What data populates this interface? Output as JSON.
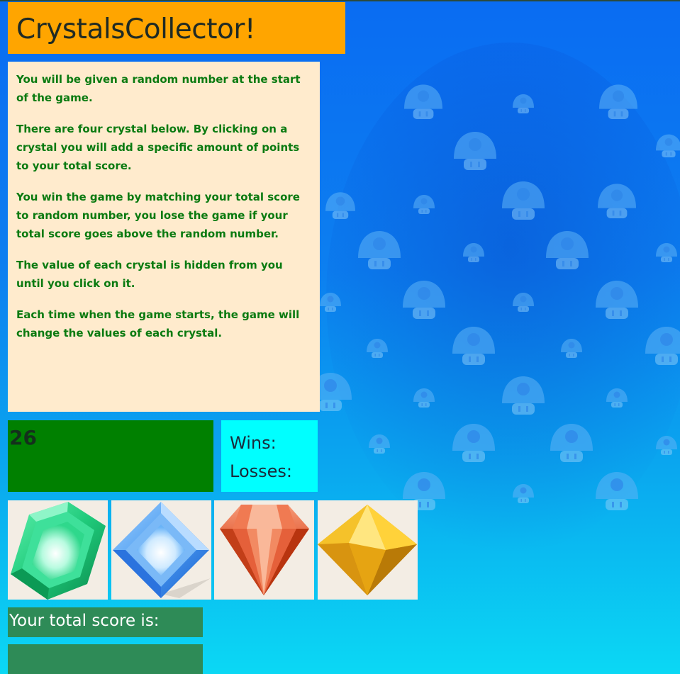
{
  "title": "CrystalsCollector!",
  "instructions": [
    "You will be given a random number at the start of the game.",
    "There are four crystal below. By clicking on a crystal you will add a specific amount of points to your total score.",
    "You win the game by matching your total score to random number, you lose the game if your total score goes above the random number.",
    "The value of each crystal is hidden from you until you click on it.",
    "Each time when the game starts, the game will change the values of each crystal."
  ],
  "random_number": "26",
  "stats": {
    "wins_label": "Wins:",
    "losses_label": "Losses:"
  },
  "crystals": [
    {
      "icon": "green-emerald-icon",
      "color": "#1fc97a"
    },
    {
      "icon": "blue-diamond-icon",
      "color": "#4a9bf0"
    },
    {
      "icon": "red-ruby-icon",
      "color": "#e0522a"
    },
    {
      "icon": "yellow-topaz-icon",
      "color": "#f0b014"
    }
  ],
  "score": {
    "label": "Your total score is:",
    "value": ""
  },
  "colors": {
    "title_bg": "#ffa500",
    "instructions_bg": "#ffebcd",
    "instructions_text": "#0a7a10",
    "random_bg": "#008000",
    "stats_bg": "#00ffff",
    "score_bg": "#2e8b57"
  }
}
